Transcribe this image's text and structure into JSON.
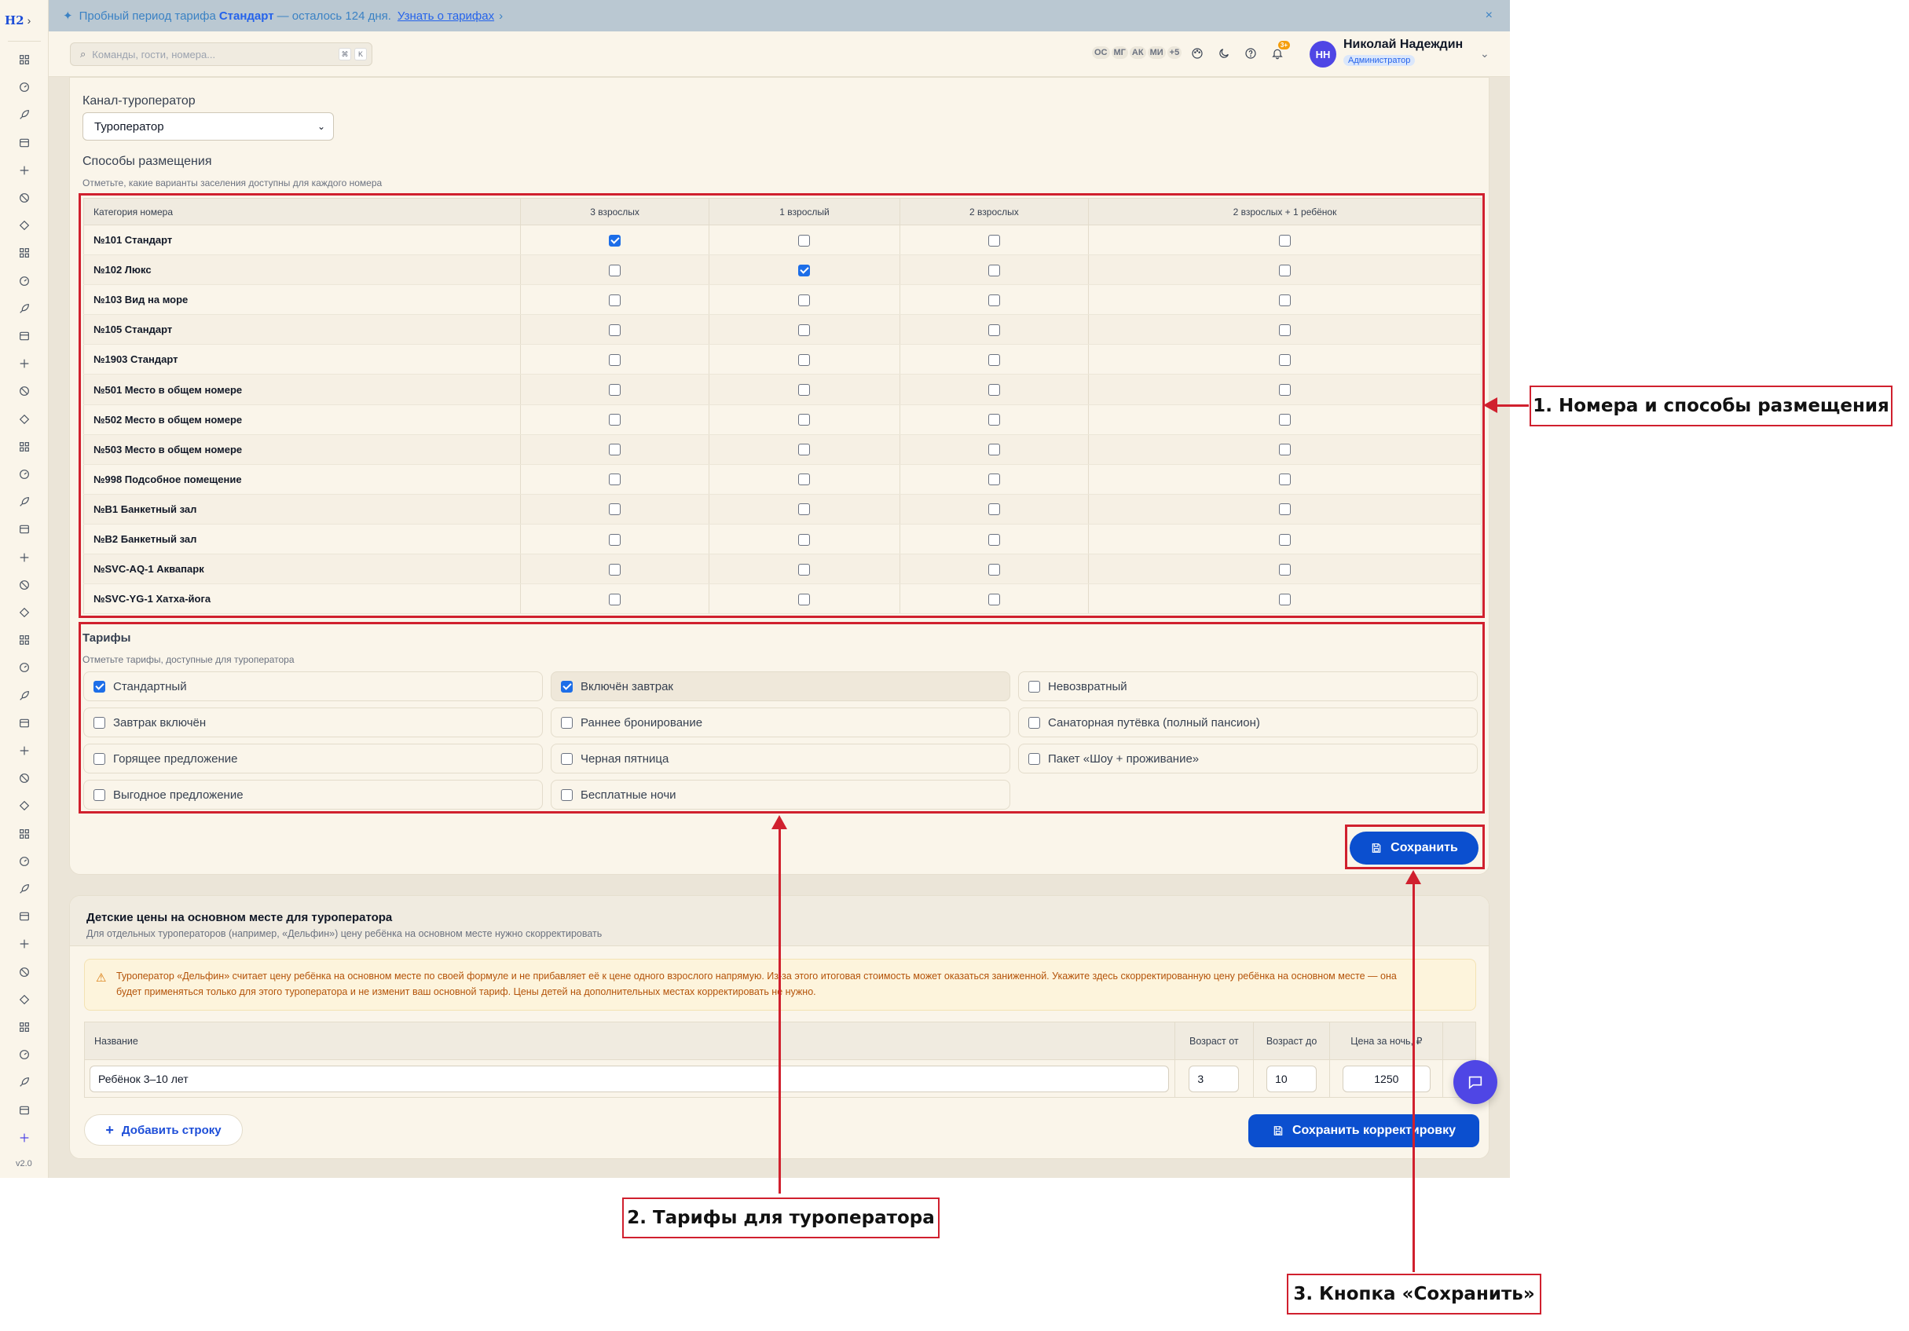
{
  "app": {
    "logo": "H2",
    "version": "v2.0",
    "sidebar_icons": [
      "grid-icon",
      "dashboard-icon",
      "rocket-icon",
      "gauge-icon",
      "bell-service-icon",
      "table-icon",
      "clipboard-icon",
      "building-icon",
      "sparkle-icon",
      "file-icon",
      "pyramid-icon",
      "dollar-doc-icon",
      "card-icon",
      "card2-icon",
      "ban-icon",
      "tag-icon",
      "bell2-icon",
      "alarm-icon",
      "shield-icon",
      "sparkle2-icon",
      "compass-icon",
      "clock-icon",
      "globe-icon",
      "phone-icon",
      "calendar-icon",
      "chart-bar-icon",
      "users-icon",
      "users2-icon",
      "pie-icon",
      "building2-icon",
      "building3-icon",
      "doc-icon",
      "money-icon",
      "heart-icon",
      "user-gear-icon",
      "chat-icon",
      "phone-call-icon",
      "award-icon",
      "gift-icon",
      "megaphone-icon"
    ]
  },
  "banner": {
    "prefix": "Пробный период тарифа",
    "plan": "Стандарт",
    "suffix": "— осталось 124 дня.",
    "link": "Узнать о тарифах",
    "link_chevron": "›",
    "close": "×"
  },
  "topbar": {
    "search_placeholder": "Команды, гости, номера...",
    "kbd1": "⌘",
    "kbd2": "K",
    "presence": [
      "ОС",
      "МГ",
      "АК",
      "МИ",
      "+5"
    ],
    "notif_count": "3+",
    "avatar": "НН",
    "user_name": "Николай Надеждин",
    "user_role": "Администратор"
  },
  "channel": {
    "label": "Канал-туроператор",
    "value": "Туроператор"
  },
  "placement": {
    "title": "Способы размещения",
    "subtitle": "Отметьте, какие варианты заселения доступны для каждого номера",
    "columns": [
      "Категория номера",
      "3 взрослых",
      "1 взрослый",
      "2 взрослых",
      "2 взрослых + 1 ребёнок"
    ],
    "rows": [
      {
        "name": "№101 Стандарт",
        "checks": [
          true,
          false,
          false,
          false
        ]
      },
      {
        "name": "№102 Люкс",
        "checks": [
          false,
          true,
          false,
          false
        ]
      },
      {
        "name": "№103 Вид на море",
        "checks": [
          false,
          false,
          false,
          false
        ]
      },
      {
        "name": "№105 Стандарт",
        "checks": [
          false,
          false,
          false,
          false
        ]
      },
      {
        "name": "№1903 Стандарт",
        "checks": [
          false,
          false,
          false,
          false
        ]
      },
      {
        "name": "№501 Место в общем номере",
        "checks": [
          false,
          false,
          false,
          false
        ]
      },
      {
        "name": "№502 Место в общем номере",
        "checks": [
          false,
          false,
          false,
          false
        ]
      },
      {
        "name": "№503 Место в общем номере",
        "checks": [
          false,
          false,
          false,
          false
        ]
      },
      {
        "name": "№998 Подсобное помещение",
        "checks": [
          false,
          false,
          false,
          false
        ]
      },
      {
        "name": "№B1 Банкетный зал",
        "checks": [
          false,
          false,
          false,
          false
        ]
      },
      {
        "name": "№B2 Банкетный зал",
        "checks": [
          false,
          false,
          false,
          false
        ]
      },
      {
        "name": "№SVC-AQ-1 Аквапарк",
        "checks": [
          false,
          false,
          false,
          false
        ]
      },
      {
        "name": "№SVC-YG-1 Хатха-йога",
        "checks": [
          false,
          false,
          false,
          false
        ]
      }
    ]
  },
  "tariffs": {
    "title": "Тарифы",
    "subtitle": "Отметьте тарифы, доступные для туроператора",
    "items": [
      {
        "label": "Стандартный",
        "checked": true
      },
      {
        "label": "Включён завтрак",
        "checked": true
      },
      {
        "label": "Невозвратный",
        "checked": false
      },
      {
        "label": "Завтрак включён",
        "checked": false
      },
      {
        "label": "Раннее бронирование",
        "checked": false
      },
      {
        "label": "Санаторная путёвка (полный пансион)",
        "checked": false
      },
      {
        "label": "Горящее предложение",
        "checked": false
      },
      {
        "label": "Черная пятница",
        "checked": false
      },
      {
        "label": "Пакет «Шоу + проживание»",
        "checked": false
      },
      {
        "label": "Выгодное предложение",
        "checked": false
      },
      {
        "label": "Бесплатные ночи",
        "checked": false
      }
    ]
  },
  "save_button": "Сохранить",
  "child_prices": {
    "title": "Детские цены на основном месте для туроператора",
    "subtitle": "Для отдельных туроператоров (например, «Дельфин») цену ребёнка на основном месте нужно скорректировать",
    "warning_line1": "Туроператор «Дельфин» считает цену ребёнка на основном месте по своей формуле и не прибавляет её к цене одного взрослого напрямую. Из-за этого итоговая стоимость может оказаться заниженной. Укажите здесь скорректированную цену ребёнка на основном месте — она",
    "warning_line2": "будет применяться только для этого туроператора и не изменит ваш основной тариф. Цены детей на дополнительных местах корректировать не нужно.",
    "columns": [
      "Название",
      "Возраст от",
      "Возраст до",
      "Цена за ночь, ₽"
    ],
    "row": {
      "name": "Ребёнок 3–10 лет",
      "age_from": "3",
      "age_to": "10",
      "price": "1250"
    },
    "add_row": "Добавить строку",
    "save_correction": "Сохранить корректировку"
  },
  "annotations": {
    "callout1": "1. Номера и способы размещения",
    "callout2": "2. Тарифы для туроператора",
    "callout3": "3. Кнопка «Сохранить»",
    "color": "#d0202e"
  }
}
